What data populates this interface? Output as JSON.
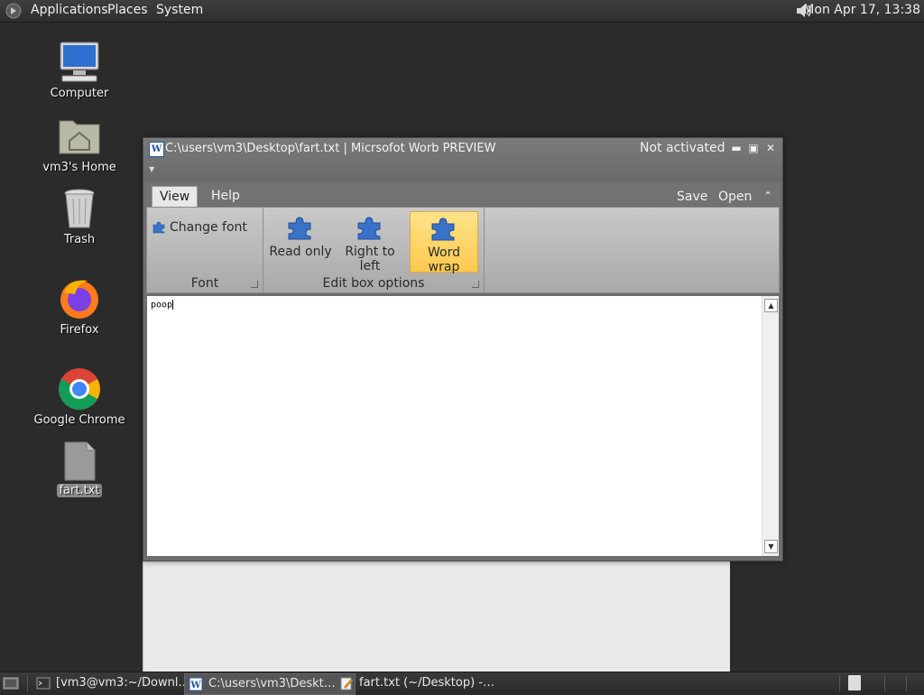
{
  "top_panel": {
    "menus": [
      "Applications",
      "Places",
      "System"
    ],
    "clock": "Mon Apr 17, 13:38"
  },
  "desktop_icons": [
    {
      "label": "Computer",
      "icon": "computer-icon"
    },
    {
      "label": "vm3's Home",
      "icon": "home-folder-icon"
    },
    {
      "label": "Trash",
      "icon": "trash-icon"
    },
    {
      "label": "Firefox",
      "icon": "firefox-icon"
    },
    {
      "label": "Google Chrome",
      "icon": "chrome-icon"
    },
    {
      "label": "fart.txt",
      "icon": "text-file-icon"
    }
  ],
  "window": {
    "title": "C:\\users\\vm3\\Desktop\\fart.txt | Micrsofot Worb PREVIEW",
    "status": "Not activated",
    "controls": {
      "minimize": "▬",
      "maximize": "▣",
      "close": "✕"
    }
  },
  "ribbon": {
    "tabs": [
      "View",
      "Help"
    ],
    "active_tab": "View",
    "right_actions": [
      "Save",
      "Open"
    ],
    "groups": {
      "font": {
        "title": "Font",
        "change_font": "Change font"
      },
      "edit_box": {
        "title": "Edit box options",
        "buttons": [
          "Read only",
          "Right to left",
          "Word wrap"
        ],
        "active_button": "Word wrap"
      }
    }
  },
  "editor": {
    "content": "poop"
  },
  "taskbar": {
    "items": [
      {
        "label": "[vm3@vm3:~/Downl…",
        "icon": "terminal-icon"
      },
      {
        "label": "C:\\users\\vm3\\Deskt…",
        "icon": "worb-app-icon"
      },
      {
        "label": "fart.txt (~/Desktop) -…",
        "icon": "text-editor-icon"
      }
    ]
  },
  "colors": {
    "accent_active_button": "#fcc94f",
    "panel": "#2e2e2e",
    "window_frame": "#6e6e6e"
  }
}
